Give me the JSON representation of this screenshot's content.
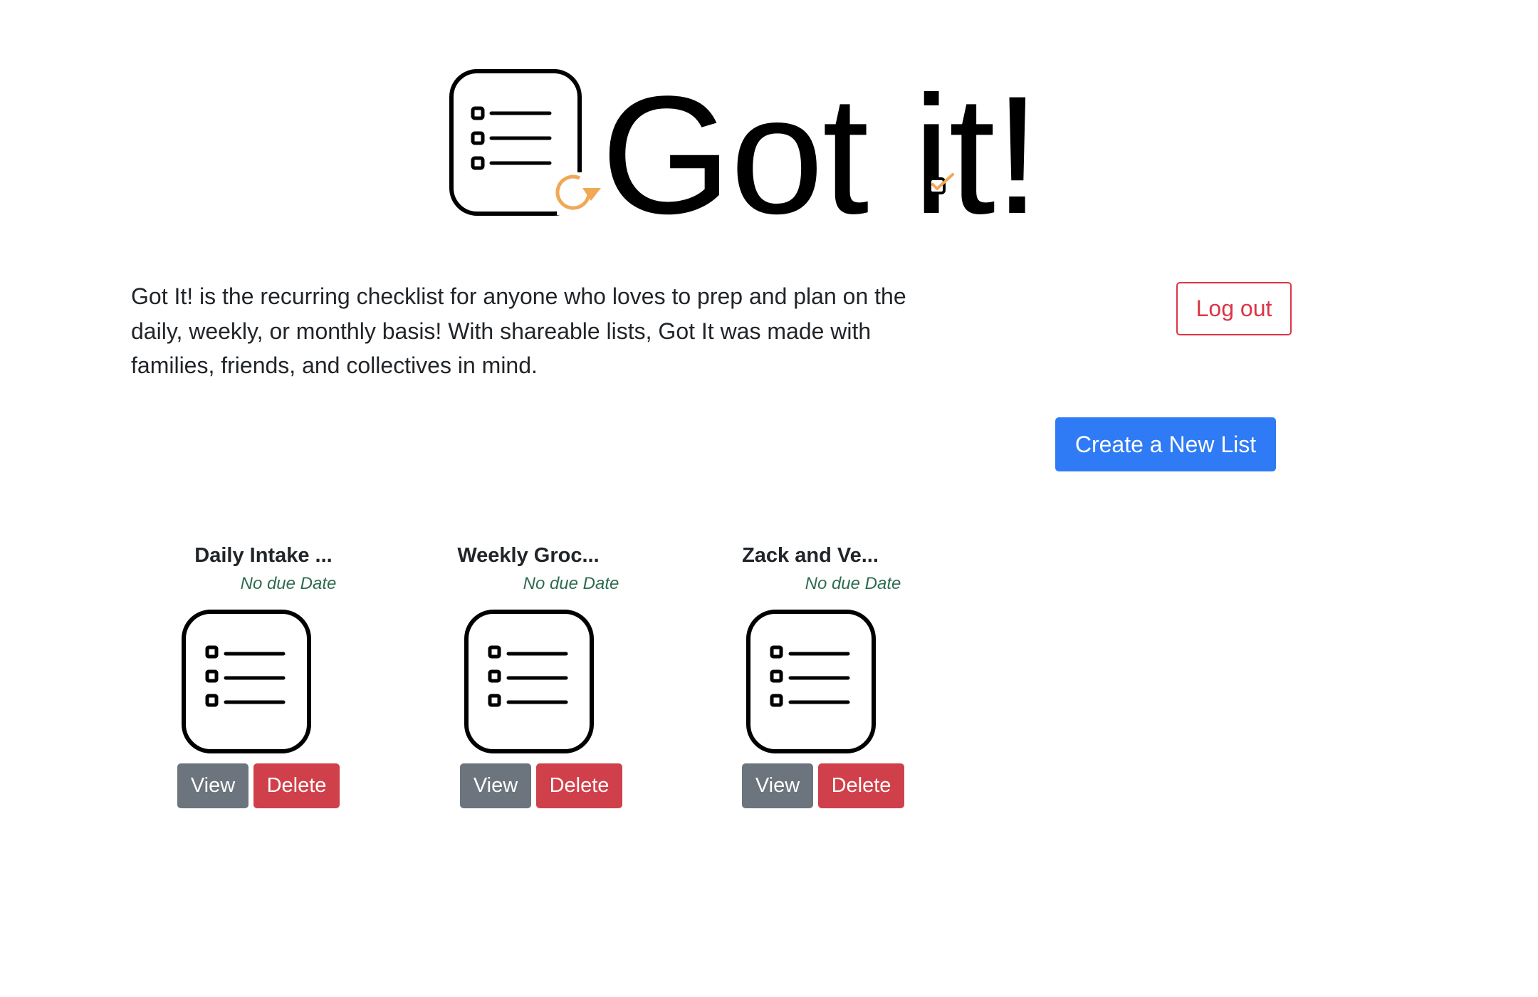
{
  "header": {
    "logo_text": "Got it!"
  },
  "description": "Got It! is the recurring checklist for anyone who loves to prep and plan on the daily, weekly, or monthly basis! With shareable lists, Got It was made with families, friends, and collectives in mind.",
  "actions": {
    "logout_label": "Log out",
    "create_label": "Create a New List"
  },
  "lists": [
    {
      "title": "Daily Intake ...",
      "due": "No due Date",
      "view_label": "View",
      "delete_label": "Delete"
    },
    {
      "title": "Weekly Groc...",
      "due": "No due Date",
      "view_label": "View",
      "delete_label": "Delete"
    },
    {
      "title": "Zack and Ve...",
      "due": "No due Date",
      "view_label": "View",
      "delete_label": "Delete"
    }
  ],
  "icons": {
    "logo_icon": "checklist-refresh-icon",
    "list_icon": "checklist-icon",
    "logo_check": "checkbox-check-icon"
  },
  "colors": {
    "primary": "#2f7bf5",
    "danger": "#dc3545",
    "secondary": "#6c757d",
    "accent_orange": "#f0a856",
    "due_text": "#2e6b4f"
  }
}
